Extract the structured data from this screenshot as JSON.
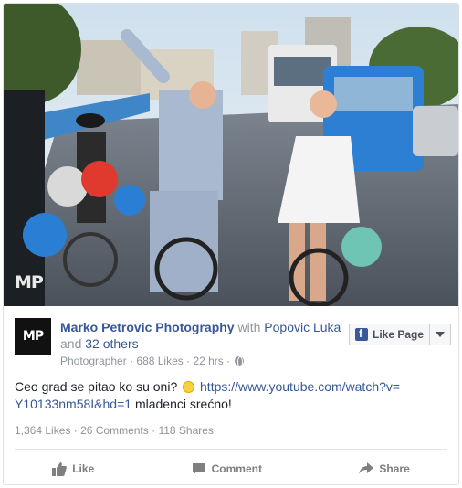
{
  "photo": {
    "watermark": "MP"
  },
  "post": {
    "avatar_text": "MP",
    "page_name": "Marko Petrovic Photography",
    "with_word": "with",
    "tagged_person": "Popovic Luka",
    "and_word": "and",
    "others": "32 others",
    "category": "Photographer",
    "page_likes": "688 Likes",
    "time": "22 hrs",
    "like_page_label": "Like Page",
    "text_before_link": "Ceo grad se pitao ko su oni?",
    "link": "https://www.youtube.com/watch?v=Y10133nm58I&hd=1",
    "text_after_link": "mladenci srećno!",
    "likes_count": "1,364 Likes",
    "comments_count": "26 Comments",
    "shares_count": "118 Shares"
  },
  "actions": {
    "like": "Like",
    "comment": "Comment",
    "share": "Share"
  },
  "icons": {
    "like": "thumbs-up-icon",
    "comment": "comment-bubble-icon",
    "share": "share-arrow-icon",
    "globe": "globe-icon",
    "facebook": "facebook-f-icon",
    "smiley": "smiley-emoji-icon"
  },
  "colors": {
    "link": "#365899",
    "meta": "#90949c",
    "fb_blue": "#3b5998"
  }
}
